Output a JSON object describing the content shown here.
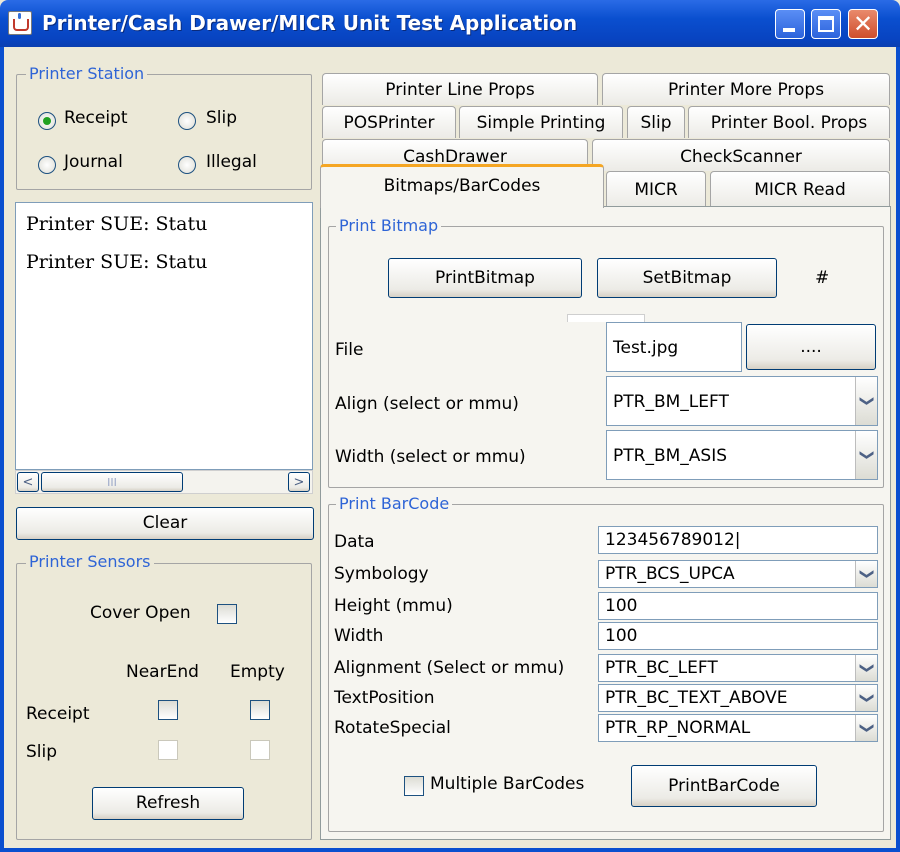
{
  "window": {
    "title": "Printer/Cash Drawer/MICR Unit Test Application",
    "close_glyph": "✕"
  },
  "printer_station": {
    "legend": "Printer Station",
    "options": [
      {
        "label": "Receipt",
        "selected": true
      },
      {
        "label": "Slip",
        "selected": false
      },
      {
        "label": "Journal",
        "selected": false
      },
      {
        "label": "Illegal",
        "selected": false
      }
    ]
  },
  "log": {
    "lines": [
      "Printer SUE: Statu",
      "Printer SUE: Statu"
    ]
  },
  "scrollbar": {
    "left_arrow": "<",
    "right_arrow": ">",
    "thumb": "III"
  },
  "clear_button": "Clear",
  "printer_sensors": {
    "legend": "Printer Sensors",
    "cover_open": "Cover Open",
    "col_nearend": "NearEnd",
    "col_empty": "Empty",
    "row_receipt": "Receipt",
    "row_slip": "Slip",
    "refresh": "Refresh"
  },
  "tabs": {
    "row1": [
      "Printer Line Props",
      "Printer More Props"
    ],
    "row2": [
      "POSPrinter",
      "Simple Printing",
      "Slip",
      "Printer Bool. Props"
    ],
    "row3": [
      "CashDrawer",
      "CheckScanner"
    ],
    "row4": [
      "Bitmaps/BarCodes",
      "MICR",
      "MICR Read"
    ],
    "selected": "Bitmaps/BarCodes"
  },
  "print_bitmap": {
    "legend": "Print Bitmap",
    "print_button": "PrintBitmap",
    "set_button": "SetBitmap",
    "hash": "#",
    "file_label": "File",
    "file_value": "Test.jpg",
    "browse_button": "....",
    "align_label": "Align (select or mmu)",
    "align_value": "PTR_BM_LEFT",
    "width_label": "Width (select or mmu)",
    "width_value": "PTR_BM_ASIS"
  },
  "print_barcode": {
    "legend": "Print BarCode",
    "data_label": "Data",
    "data_value": "123456789012|",
    "symbology_label": "Symbology",
    "symbology_value": "PTR_BCS_UPCA",
    "height_label": "Height (mmu)",
    "height_value": "100",
    "width_label": "Width",
    "width_value": "100",
    "alignment_label": "Alignment (Select or mmu)",
    "alignment_value": "PTR_BC_LEFT",
    "textpos_label": "TextPosition",
    "textpos_value": "PTR_BC_TEXT_ABOVE",
    "rotate_label": "RotateSpecial",
    "rotate_value": "PTR_RP_NORMAL",
    "multiple_label": "Multiple BarCodes",
    "print_button": "PrintBarCode"
  },
  "combo_arrow_glyph": "❯",
  "colors": {
    "titlebar": "#0A4FCF",
    "legend": "#2e64d6",
    "tab_accent": "#f5a623",
    "radio_dot": "#21a121"
  }
}
